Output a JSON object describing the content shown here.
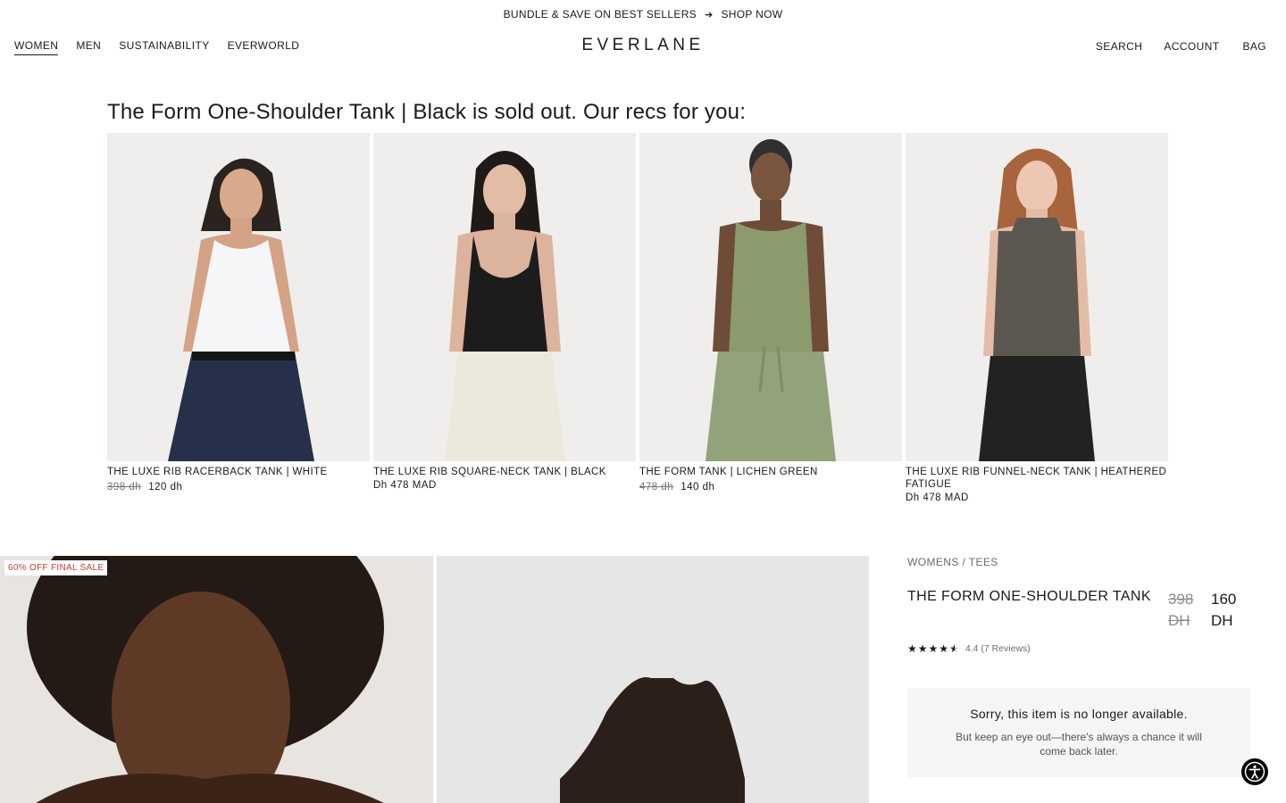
{
  "promo": {
    "text": "BUNDLE & SAVE ON BEST SELLERS",
    "link": "SHOP NOW",
    "arrow_icon": "arrow-right-icon"
  },
  "nav": {
    "left": [
      "WOMEN",
      "MEN",
      "SUSTAINABILITY",
      "EVERWORLD"
    ],
    "active": "WOMEN",
    "logo": "EVERLANE",
    "search": "SEARCH",
    "account": "ACCOUNT",
    "bag": "BAG"
  },
  "recs": {
    "title": "The Form One-Shoulder Tank | Black is sold out. Our recs for you:",
    "items": [
      {
        "name": "THE LUXE RIB RACERBACK TANK | WHITE",
        "old_price": "398 dh",
        "price": "120 dh",
        "top_color": "#f6f6f8",
        "bottom_color": "#26304a"
      },
      {
        "name": "THE LUXE RIB SQUARE-NECK TANK | BLACK",
        "old_price": "",
        "price": "Dh 478 MAD",
        "top_color": "#1c1c1c",
        "bottom_color": "#ece8dc"
      },
      {
        "name": "THE FORM TANK | LICHEN GREEN",
        "old_price": "478 dh",
        "price": "140 dh",
        "top_color": "#8b9b6e",
        "bottom_color": "#92a27a"
      },
      {
        "name": "THE LUXE RIB FUNNEL-NECK TANK | HEATHERED FATIGUE",
        "old_price": "",
        "price": "Dh 478 MAD",
        "top_color": "#5c5851",
        "bottom_color": "#222222"
      }
    ]
  },
  "product": {
    "badge": "60% OFF FINAL SALE",
    "breadcrumb": "WOMENS / TEES",
    "title": "THE FORM ONE-SHOULDER TANK",
    "old_price": "398 DH",
    "new_price": "160 DH",
    "rating": 4.4,
    "rating_text": "4.4 (7 Reviews)",
    "unavailable_title": "Sorry, this item is no longer available.",
    "unavailable_text": "But keep an eye out—there's always a chance it will come back later."
  },
  "accessibility_icon": "accessibility-icon",
  "colors": {
    "sale_badge": "#c2432f",
    "text": "#1a1a1a"
  }
}
